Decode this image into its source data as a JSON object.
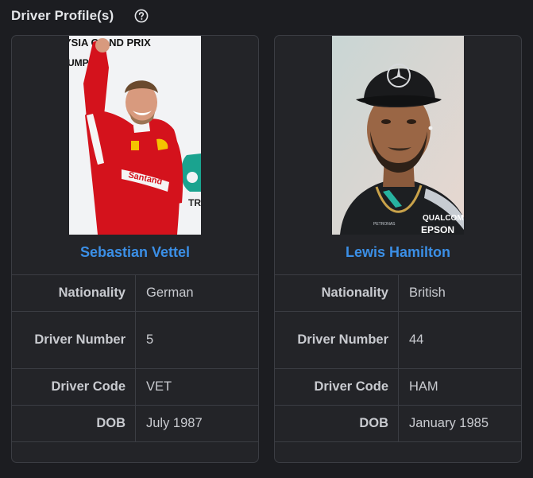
{
  "header": {
    "title": "Driver Profile(s)",
    "help_icon": "question-circle-icon"
  },
  "drivers": [
    {
      "name": "Sebastian Vettel",
      "photo_banner_text": "YSIA G AND PRIX",
      "photo_side_text": "UMP",
      "photo_suit_text": "Santand",
      "photo_logo_text": "TRO",
      "rows": [
        {
          "label": "Nationality",
          "value": "German"
        },
        {
          "label": "Driver Number",
          "value": "5"
        },
        {
          "label": "Driver Code",
          "value": "VET"
        },
        {
          "label": "DOB",
          "value": "July 1987"
        }
      ]
    },
    {
      "name": "Lewis Hamilton",
      "photo_shirt_text_1": "QUALCOMM",
      "photo_shirt_text_2": "EPSON",
      "photo_shirt_text_3": "PETRONAS",
      "rows": [
        {
          "label": "Nationality",
          "value": "British"
        },
        {
          "label": "Driver Number",
          "value": "44"
        },
        {
          "label": "Driver Code",
          "value": "HAM"
        },
        {
          "label": "DOB",
          "value": "January 1985"
        }
      ]
    }
  ],
  "colors": {
    "background": "#1c1d21",
    "card": "#232428",
    "border": "#3b3d43",
    "link": "#3b8fe6",
    "ferrari_red": "#d4121c",
    "mercedes_black": "#1d1f22"
  }
}
